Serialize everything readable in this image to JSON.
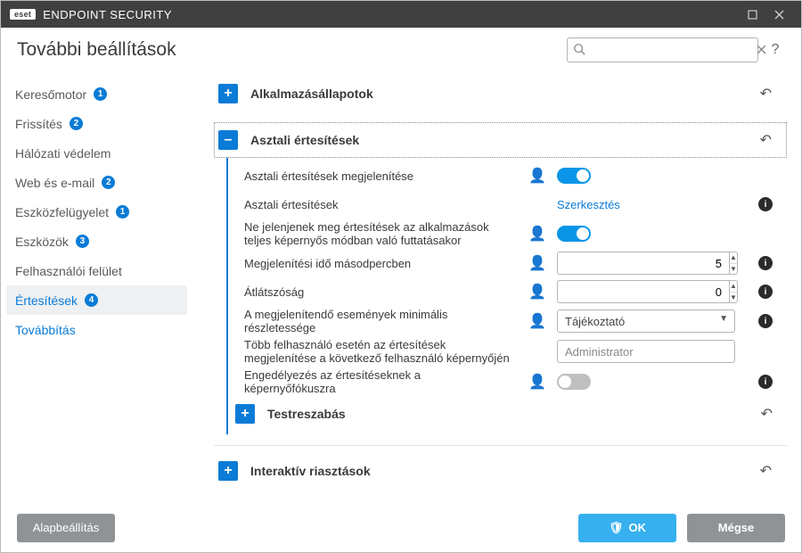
{
  "titlebar": {
    "brand_logo": "eset",
    "brand_text": "ENDPOINT SECURITY"
  },
  "header": {
    "title": "További beállítások",
    "search_placeholder": ""
  },
  "sidebar": {
    "items": [
      {
        "label": "Keresőmotor",
        "badge": "1"
      },
      {
        "label": "Frissítés",
        "badge": "2"
      },
      {
        "label": "Hálózati védelem",
        "badge": ""
      },
      {
        "label": "Web és e-mail",
        "badge": "2"
      },
      {
        "label": "Eszközfelügyelet",
        "badge": "1"
      },
      {
        "label": "Eszközök",
        "badge": "3"
      },
      {
        "label": "Felhasználói felület",
        "badge": ""
      },
      {
        "label": "Értesítések",
        "badge": "4"
      },
      {
        "label": "Továbbítás",
        "badge": ""
      }
    ]
  },
  "sections": {
    "app_states": {
      "title": "Alkalmazásállapotok"
    },
    "desktop_notifications": {
      "title": "Asztali értesítések",
      "rows": {
        "show_desktop": "Asztali értesítések megjelenítése",
        "desktop_label": "Asztali értesítések",
        "desktop_link": "Szerkesztés",
        "no_fs": "Ne jelenjenek meg értesítések az alkalmazások teljes képernyős módban való futtatásakor",
        "duration": "Megjelenítési idő másodpercben",
        "duration_val": "5",
        "transparency": "Átlátszóság",
        "transparency_val": "0",
        "min_verbosity": "A megjelenítendő események minimális részletessége",
        "verbosity_val": "Tájékoztató",
        "multiuser": "Több felhasználó esetén az értesítések megjelenítése a következő felhasználó képernyőjén",
        "multiuser_val": "Administrator",
        "allow_focus": "Engedélyezés az értesítéseknek a képernyőfókuszra"
      },
      "customization": {
        "title": "Testreszabás"
      }
    },
    "interactive_alerts": {
      "title": "Interaktív riasztások"
    }
  },
  "footer": {
    "default": "Alapbeállítás",
    "ok": "OK",
    "cancel": "Mégse"
  }
}
